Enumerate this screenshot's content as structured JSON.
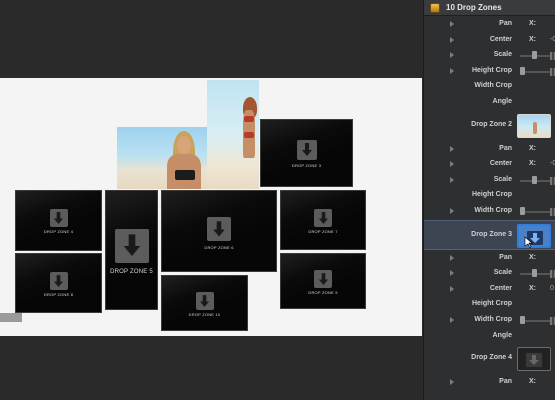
{
  "inspector": {
    "title": "10 Drop Zones",
    "x_label": "X:",
    "rows": [
      {
        "label": "Pan",
        "type": "x",
        "value": ""
      },
      {
        "label": "Center",
        "type": "x",
        "value": "-0"
      },
      {
        "label": "Scale",
        "type": "slider",
        "level": 0.6
      },
      {
        "label": "Height Crop",
        "type": "slider",
        "level": 0.0
      },
      {
        "label": "Width Crop",
        "type": "blank"
      },
      {
        "label": "Angle",
        "type": "blank"
      }
    ],
    "drop_zone_2": "Drop Zone 2",
    "rows_zone2": [
      {
        "label": "Pan",
        "type": "x",
        "value": ""
      },
      {
        "label": "Center",
        "type": "x",
        "value": "-0"
      },
      {
        "label": "Scale",
        "type": "slider",
        "level": 0.6
      },
      {
        "label": "Height Crop",
        "type": "blank"
      },
      {
        "label": "Width Crop",
        "type": "slider",
        "level": 0.0
      }
    ],
    "drop_zone_3": "Drop Zone 3",
    "rows_zone3": [
      {
        "label": "Pan",
        "type": "x",
        "value": ""
      },
      {
        "label": "Scale",
        "type": "slider",
        "level": 0.6
      },
      {
        "label": "Center",
        "type": "x",
        "value": "0"
      },
      {
        "label": "Height Crop",
        "type": "blank"
      },
      {
        "label": "Width Crop",
        "type": "slider",
        "level": 0.0
      },
      {
        "label": "Angle",
        "type": "blank"
      }
    ],
    "drop_zone_4": "Drop Zone 4",
    "rows_zone4": [
      {
        "label": "Pan",
        "type": "x",
        "value": ""
      }
    ]
  },
  "canvas": {
    "drop_zones": [
      {
        "label": "DROP ZONE 3"
      },
      {
        "label": "DROP ZONE 4"
      },
      {
        "label": "DROP ZONE 5"
      },
      {
        "label": "DROP ZONE 6"
      },
      {
        "label": "DROP ZONE 7"
      },
      {
        "label": "DROP ZONE 8"
      },
      {
        "label": "DROP ZONE 9"
      },
      {
        "label": "DROP ZONE 10"
      }
    ]
  },
  "colors": {
    "accent": "#2e7fe0",
    "panel": "#2e2f31"
  }
}
